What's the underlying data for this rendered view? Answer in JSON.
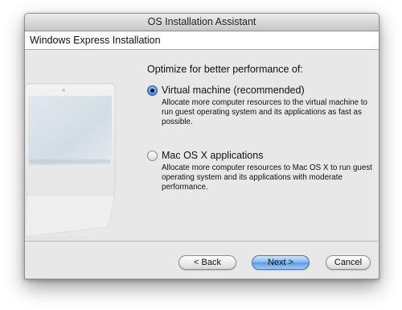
{
  "window": {
    "title": "OS Installation Assistant"
  },
  "header": {
    "title": "Windows Express Installation"
  },
  "main": {
    "prompt": "Optimize for better performance of:",
    "options": [
      {
        "label": "Virtual machine (recommended)",
        "description": "Allocate more computer resources to the virtual machine to run guest operating system and its applications as fast as possible.",
        "selected": true
      },
      {
        "label": "Mac OS X applications",
        "description": "Allocate more computer resources to Mac OS X to run guest operating system and its applications with moderate performance.",
        "selected": false
      }
    ]
  },
  "buttons": {
    "back": "< Back",
    "next": "Next >",
    "cancel": "Cancel"
  },
  "colors": {
    "accent": "#5d9ae3",
    "window_bg": "#e8e8e8"
  }
}
